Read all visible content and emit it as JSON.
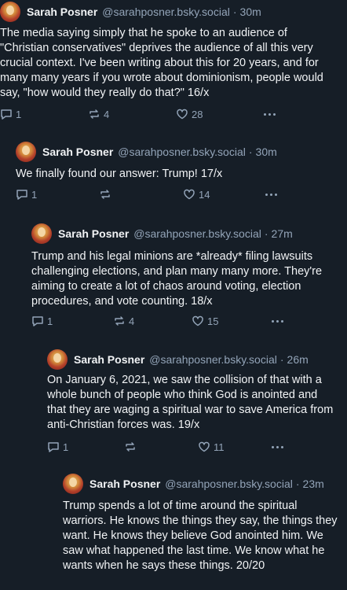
{
  "posts": [
    {
      "author": "Sarah Posner",
      "handle": "@sarahposner.bsky.social",
      "time": "30m",
      "text": "The media saying simply that he spoke to an audience of \"Christian conservatives\" deprives the audience of all this very crucial context. I've been writing about this for 20 years, and for many many years if you wrote about dominionism, people would say, \"how would they really do that?\" 16/x",
      "replies": "1",
      "reposts": "4",
      "likes": "28"
    },
    {
      "author": "Sarah Posner",
      "handle": "@sarahposner.bsky.social",
      "time": "30m",
      "text": "We finally found our answer: Trump! 17/x",
      "replies": "1",
      "reposts": "",
      "likes": "14"
    },
    {
      "author": "Sarah Posner",
      "handle": "@sarahposner.bsky.social",
      "time": "27m",
      "text": "Trump and his legal minions are *already* filing lawsuits challenging elections, and plan many many more. They're aiming to create a lot of chaos around voting, election procedures, and vote counting. 18/x",
      "replies": "1",
      "reposts": "4",
      "likes": "15"
    },
    {
      "author": "Sarah Posner",
      "handle": "@sarahposner.bsky.social",
      "time": "26m",
      "text": "On January 6, 2021, we saw the collision of that with a whole bunch of people who think God is anointed and that they are waging a spiritual war to save America from anti-Christian forces was. 19/x",
      "replies": "1",
      "reposts": "",
      "likes": "11"
    },
    {
      "author": "Sarah Posner",
      "handle": "@sarahposner.bsky.social",
      "time": "23m",
      "text": "Trump spends a lot of time around the spiritual warriors. He knows the things they say, the things they want. He knows they believe God anointed him. We saw what happened the last time. We know what he wants when he says these things. 20/20",
      "replies": "",
      "reposts": "",
      "likes": ""
    }
  ],
  "separator": "·",
  "colors": {
    "background": "#161e27",
    "text": "#f1f3f5",
    "muted": "#93a4b8",
    "thread_line": "#2e4052"
  }
}
